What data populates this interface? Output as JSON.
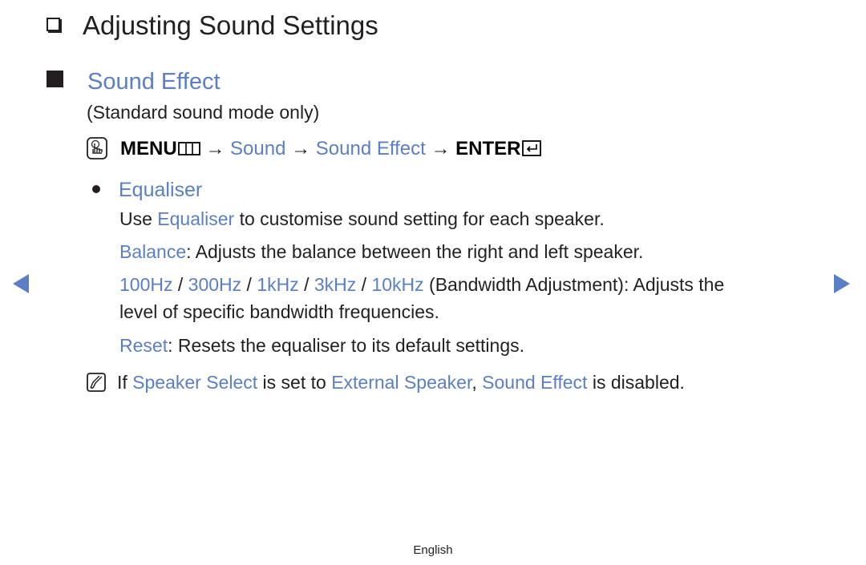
{
  "heading": {
    "icon": "checkbox-outline-icon",
    "title": "Adjusting Sound Settings"
  },
  "section": {
    "icon": "filled-square-icon",
    "title": "Sound Effect",
    "subtitle": "(Standard sound mode only)"
  },
  "menu_path": {
    "icon": "remote-hand-icon",
    "menu_label": "MENU",
    "menu_icon": "menu-grid-icon",
    "arrow": "→",
    "step1": "Sound",
    "step2": "Sound Effect",
    "enter_label": "ENTER",
    "enter_icon": "enter-return-icon"
  },
  "equaliser": {
    "title": "Equaliser",
    "desc_prefix": "Use ",
    "desc_link": "Equaliser",
    "desc_suffix": " to customise sound setting for each speaker.",
    "balance_link": "Balance",
    "balance_text": ": Adjusts the balance between the right and left speaker.",
    "bands": [
      "100Hz",
      "300Hz",
      "1kHz",
      "3kHz",
      "10kHz"
    ],
    "band_separator": " / ",
    "bands_text_line1": " (Bandwidth Adjustment): Adjusts the",
    "bands_text_line2": "level of specific bandwidth frequencies.",
    "reset_link": "Reset",
    "reset_text": ": Resets the equaliser to its default settings."
  },
  "note": {
    "icon": "note-pencil-icon",
    "t1": "If ",
    "l1": "Speaker Select",
    "t2": " is set to ",
    "l2": "External Speaker",
    "t3": ", ",
    "l3": "Sound Effect",
    "t4": " is disabled."
  },
  "nav": {
    "prev_icon": "previous-page-arrow-icon",
    "next_icon": "next-page-arrow-icon"
  },
  "footer": {
    "language": "English"
  },
  "colors": {
    "accent": "#5b7fc4",
    "text": "#231f20"
  }
}
